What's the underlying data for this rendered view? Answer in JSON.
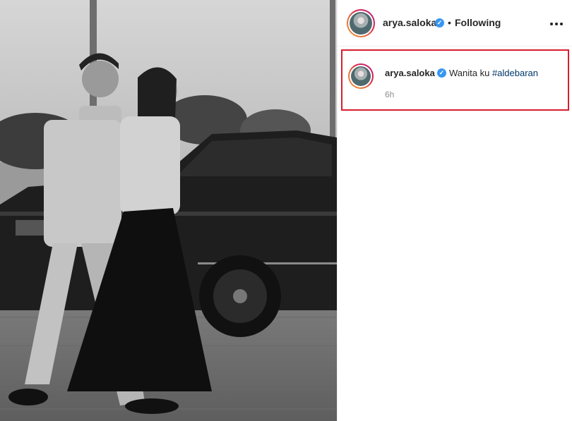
{
  "post": {
    "author": "arya.saloka",
    "follow_status": "Following",
    "separator": "•",
    "verified_mark": "✓"
  },
  "caption": {
    "author": "arya.saloka",
    "text": "Wanita ku",
    "hashtag": "#aldebaran",
    "time": "6h"
  },
  "colors": {
    "highlight_border": "#d81e2d",
    "verified_badge": "#3897f0",
    "hashtag_link": "#00376b",
    "secondary_text": "#8e8e8e"
  },
  "icons": [
    "verified-badge-icon",
    "more-options-icon"
  ]
}
